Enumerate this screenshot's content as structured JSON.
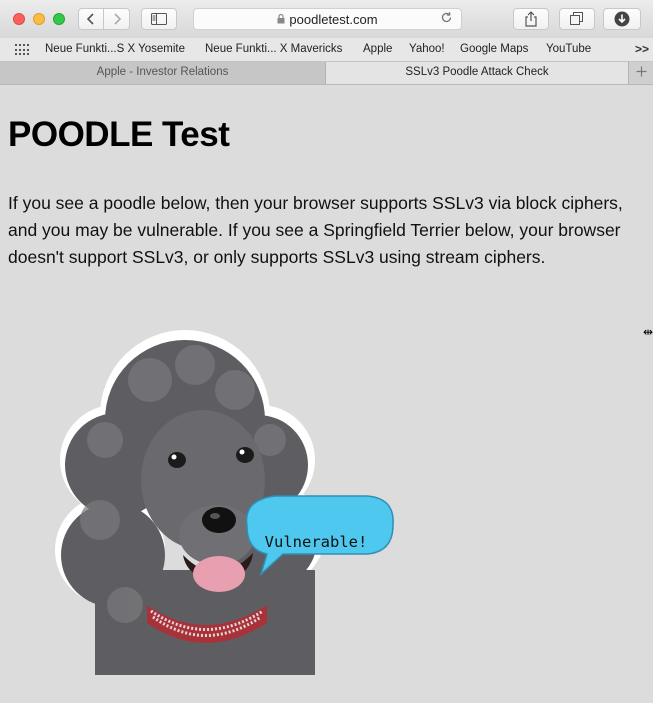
{
  "toolbar": {
    "url": "poodletest.com"
  },
  "bookmarks": [
    "Neue Funkti...S X Yosemite",
    "Neue Funkti... X Mavericks",
    "Apple",
    "Yahoo!",
    "Google Maps",
    "YouTube"
  ],
  "bookmarks_more": ">>",
  "tabs": [
    {
      "label": "Apple - Investor Relations",
      "active": false
    },
    {
      "label": "SSLv3 Poodle Attack Check",
      "active": true
    }
  ],
  "page": {
    "title": "POODLE Test",
    "description": "If you see a poodle below, then your browser supports SSLv3 via block ciphers, and you may be vulnerable. If you see a Springfield Terrier below, your browser doesn't support SSLv3, or only supports SSLv3 using stream ciphers.",
    "bubble_text": "Vulnerable!"
  },
  "colors": {
    "bubble": "#4fc8f0",
    "collar": "#a8323a",
    "close": "#fc605c",
    "minimize": "#fdbc40",
    "zoom": "#34c84a"
  }
}
